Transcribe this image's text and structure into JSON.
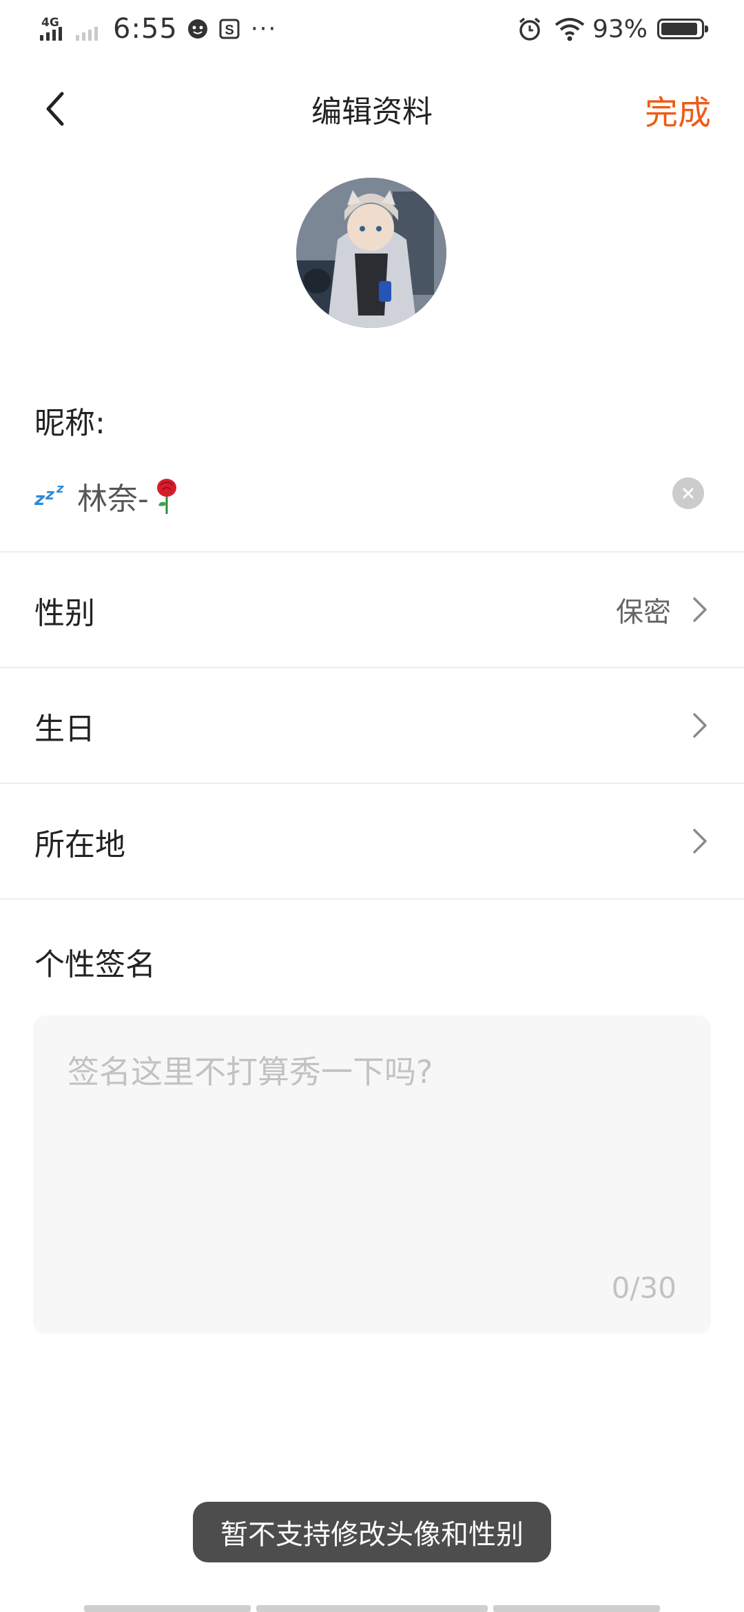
{
  "status_bar": {
    "network": "4G",
    "time": "6:55",
    "more": "···",
    "battery_percent": "93%",
    "battery_level": 0.93,
    "icons": [
      "signal-icon",
      "signal-2-icon",
      "face-icon",
      "s-app-icon",
      "alarm-icon",
      "wifi-icon",
      "battery-icon"
    ]
  },
  "nav": {
    "title": "编辑资料",
    "done_label": "完成",
    "back_icon": "chevron-left-icon"
  },
  "profile": {
    "nickname_label": "昵称:",
    "nickname_emoji_prefix": "💤",
    "nickname_text": "林奈-",
    "nickname_emoji_suffix": "🌹"
  },
  "rows": [
    {
      "label": "性别",
      "value": "保密"
    },
    {
      "label": "生日",
      "value": ""
    },
    {
      "label": "所在地",
      "value": ""
    }
  ],
  "signature": {
    "label": "个性签名",
    "placeholder": "签名这里不打算秀一下吗?",
    "counter": "0/30"
  },
  "toast": {
    "text": "暂不支持修改头像和性别"
  },
  "colors": {
    "accent": "#ef5b15",
    "divider": "#eeeeee",
    "toast_bg": "#4d4d4d",
    "input_bg": "#f7f7f7"
  }
}
